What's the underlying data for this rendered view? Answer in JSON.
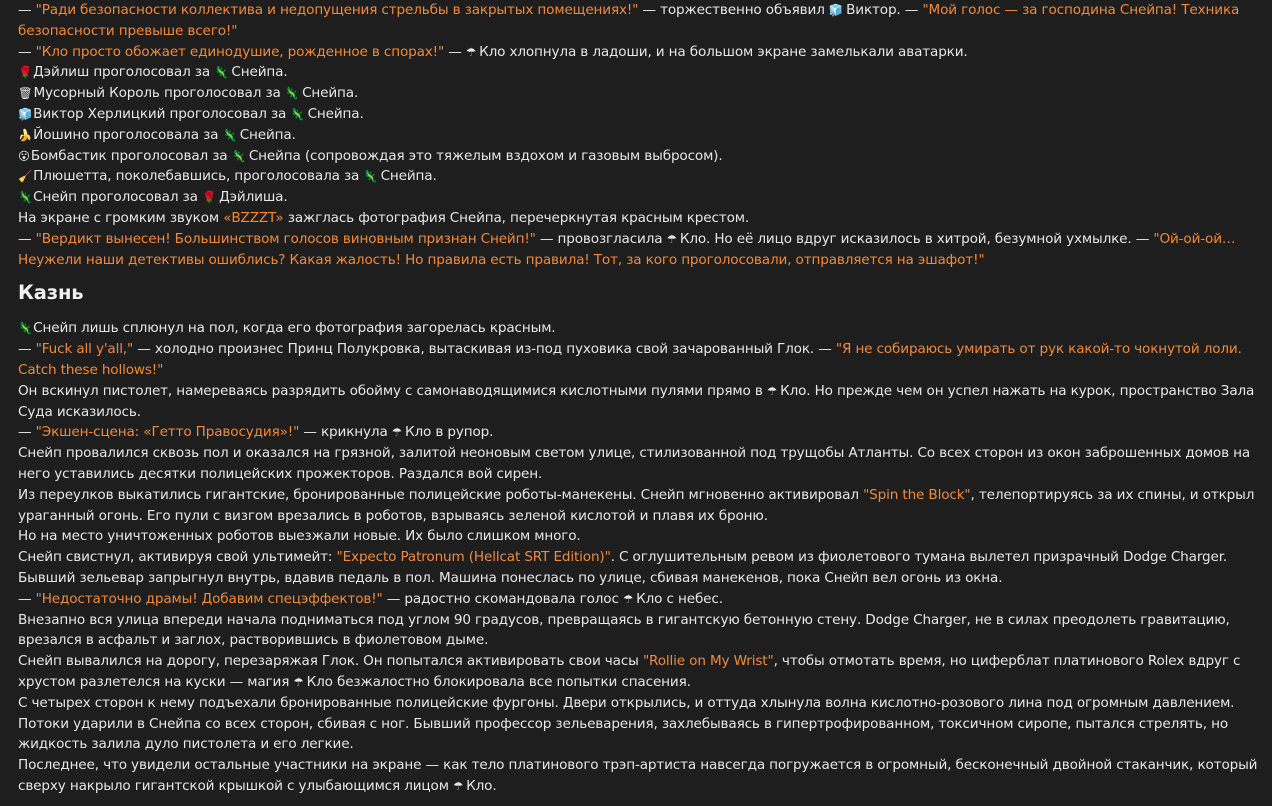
{
  "icons": {
    "viktor": "🧊",
    "klo": "☂",
    "snape": "🦎",
    "daylish": "🌹",
    "trash": "🗑",
    "yoshino": "🍌",
    "bombastic": "😮",
    "plush": "🧹"
  },
  "colors": {
    "background": "#1e1e1e",
    "text": "#e6e6e6",
    "quote": "#f28a3c"
  },
  "section1": {
    "p1": {
      "dash": "— ",
      "q1": "\"Ради безопасности коллектива и недопущения стрельбы в закрытых помещениях!\"",
      "t1": " — торжественно объявил ",
      "name": "Виктор. — ",
      "q2": "\"Мой голос — за господина Снейпа! Техника безопасности превыше всего!\""
    },
    "p2": {
      "dash": "— ",
      "q1": "\"Кло просто обожает единодушие, рожденное в спорах!\"",
      "t1": " — ",
      "t2": "Кло хлопнула в ладоши, и на большом экране замелькали аватарки."
    },
    "votes": [
      {
        "voter": "Дэйлиш проголосовал за ",
        "target": "Снейпа."
      },
      {
        "voter": "Мусорный Король проголосовал за ",
        "target": "Снейпа."
      },
      {
        "voter": "Виктор Херлицкий проголосовал за ",
        "target": "Снейпа."
      },
      {
        "voter": "Йошино проголосовала за ",
        "target": "Снейпа."
      },
      {
        "voter": "Бомбастик проголосовал за ",
        "target": "Снейпа (сопровождая это тяжелым вздохом и газовым выбросом)."
      },
      {
        "voter": "Плюшетта, поколебавшись, проголосовала за ",
        "target": "Снейпа."
      },
      {
        "voter": "Снейп проголосовал за ",
        "target": "Дэйлиша."
      }
    ],
    "p3": {
      "t1": "На экране с громким звуком ",
      "q1": "«BZZZT»",
      "t2": " зажглась фотография Снейпа, перечеркнутая красным крестом."
    },
    "p4": {
      "dash": "— ",
      "q1": "\"Вердикт вынесен! Большинством голосов виновным признан Снейп!\"",
      "t1": " — провозгласила ",
      "t2": "Кло. Но её лицо вдруг исказилось в хитрой, безумной ухмылке. — ",
      "q2": "\"Ой-ой-ой… Неужели наши детективы ошиблись? Какая жалость! Но правила есть правила! Тот, за кого проголосовали, отправляется на эшафот!\""
    }
  },
  "section2": {
    "heading": "Казнь",
    "p1": "Снейп лишь сплюнул на пол, когда его фотография загорелась красным.",
    "p2": {
      "dash": "— ",
      "q1": "\"Fuck all y'all,\"",
      "t1": " — холодно произнес Принц Полукровка, вытаскивая из-под пуховика свой зачарованный Глок. — ",
      "q2": "\"Я не собираюсь умирать от рук какой-то чокнутой лоли. Catch these hollows!\""
    },
    "p3": {
      "t1": "Он вскинул пистолет, намереваясь разрядить обойму с самонаводящимися кислотными пулями прямо в ",
      "t2": "Кло. Но прежде чем он успел нажать на курок, пространство Зала Суда исказилось."
    },
    "p4": {
      "dash": "— ",
      "q1": "\"Экшен-сцена: «Гетто Правосудия»!\"",
      "t1": " — крикнула ",
      "t2": "Кло в рупор."
    },
    "p5": "Снейп провалился сквозь пол и оказался на грязной, залитой неоновым светом улице, стилизованной под трущобы Атланты. Со всех сторон из окон заброшенных домов на него уставились десятки полицейских прожекторов. Раздался вой сирен.",
    "p6": {
      "t1": "Из переулков выкатились гигантские, бронированные полицейские роботы-манекены. Снейп мгновенно активировал ",
      "q1": "\"Spin the Block\"",
      "t2": ", телепортируясь за их спины, и открыл ураганный огонь. Его пули с визгом врезались в роботов, взрываясь зеленой кислотой и плавя их броню."
    },
    "p7": "Но на место уничтоженных роботов выезжали новые. Их было слишком много.",
    "p8": {
      "t1": "Снейп свистнул, активируя свой ультимейт: ",
      "q1": "\"Expecto Patronum (Hellcat SRT Edition)\"",
      "t2": ". С оглушительным ревом из фиолетового тумана вылетел призрачный Dodge Charger. Бывший зельевар запрыгнул внутрь, вдавив педаль в пол. Машина понеслась по улице, сбивая манекенов, пока Снейп вел огонь из окна."
    },
    "p9": {
      "dash": "— ",
      "q1": "\"Недостаточно драмы! Добавим спецэффектов!\"",
      "t1": " — радостно скомандовала голос ",
      "t2": "Кло с небес."
    },
    "p10": "Внезапно вся улица впереди начала подниматься под углом 90 градусов, превращаясь в гигантскую бетонную стену. Dodge Charger, не в силах преодолеть гравитацию, врезался в асфальт и заглох, растворившись в фиолетовом дыме.",
    "p11": {
      "t1": "Снейп вывалился на дорогу, перезаряжая Глок. Он попытался активировать свои часы ",
      "q1": "\"Rollie on My Wrist\"",
      "t2": ", чтобы отмотать время, но циферблат платинового Rolex вдруг с хрустом разлетелся на куски — магия ",
      "t3": "Кло безжалостно блокировала все попытки спасения."
    },
    "p12": "С четырех сторон к нему подъехали бронированные полицейские фургоны. Двери открылись, и оттуда хлынула волна кислотно-розового лина под огромным давлением. Потоки ударили в Снейпа со всех сторон, сбивая с ног. Бывший профессор зельеварения, захлебываясь в гипертрофированном, токсичном сиропе, пытался стрелять, но жидкость залила дуло пистолета и его легкие.",
    "p13": {
      "t1": "Последнее, что увидели остальные участники на экране — как тело платинового трэп-артиста навсегда погружается в огромный, бесконечный двойной стаканчик, который сверху накрыло гигантской крышкой с улыбающимся лицом ",
      "t2": "Кло."
    }
  }
}
